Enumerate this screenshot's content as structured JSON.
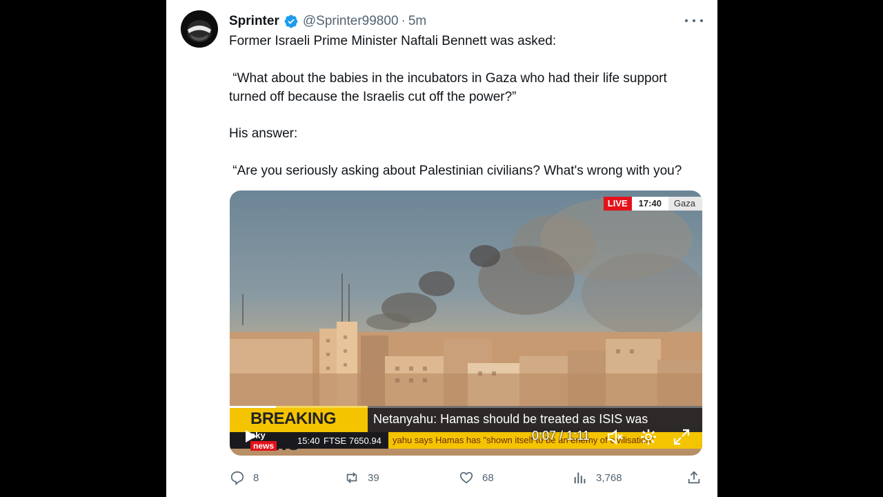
{
  "tweet": {
    "author_name": "Sprinter",
    "handle": "@Sprinter99800",
    "separator": "·",
    "time": "5m",
    "lines": [
      "Former Israeli Prime Minister Naftali Bennett was asked:",
      " “What about the babies in the incubators in Gaza who had their life support",
      "turned off because the Israelis cut off the power?”",
      "His answer:",
      " “Are you seriously asking about Palestinian civilians? What's wrong with you?"
    ]
  },
  "video": {
    "live_label": "LIVE",
    "clock": "17:40",
    "location": "Gaza",
    "breaking_label": "BREAKING NEWS",
    "headline": "Netanyahu: Hamas should be treated as ISIS was",
    "channel": "sky",
    "channel_pill": "news",
    "ticker_time": "15:40",
    "ticker_index": "FTSE 7650.94",
    "ticker_text": "yahu says Hamas has \"shown itself to be an enemy of civilisation\"",
    "timecode": "0:07 / 1:11",
    "progress": 0.098
  },
  "actions": {
    "replies": "8",
    "reposts": "39",
    "likes": "68",
    "views": "3,768"
  },
  "colors": {
    "verified": "#1d9bf0",
    "text_primary": "#0f1419",
    "text_secondary": "#536471",
    "live_red": "#e3121b",
    "breaking_yellow": "#f5c400"
  }
}
